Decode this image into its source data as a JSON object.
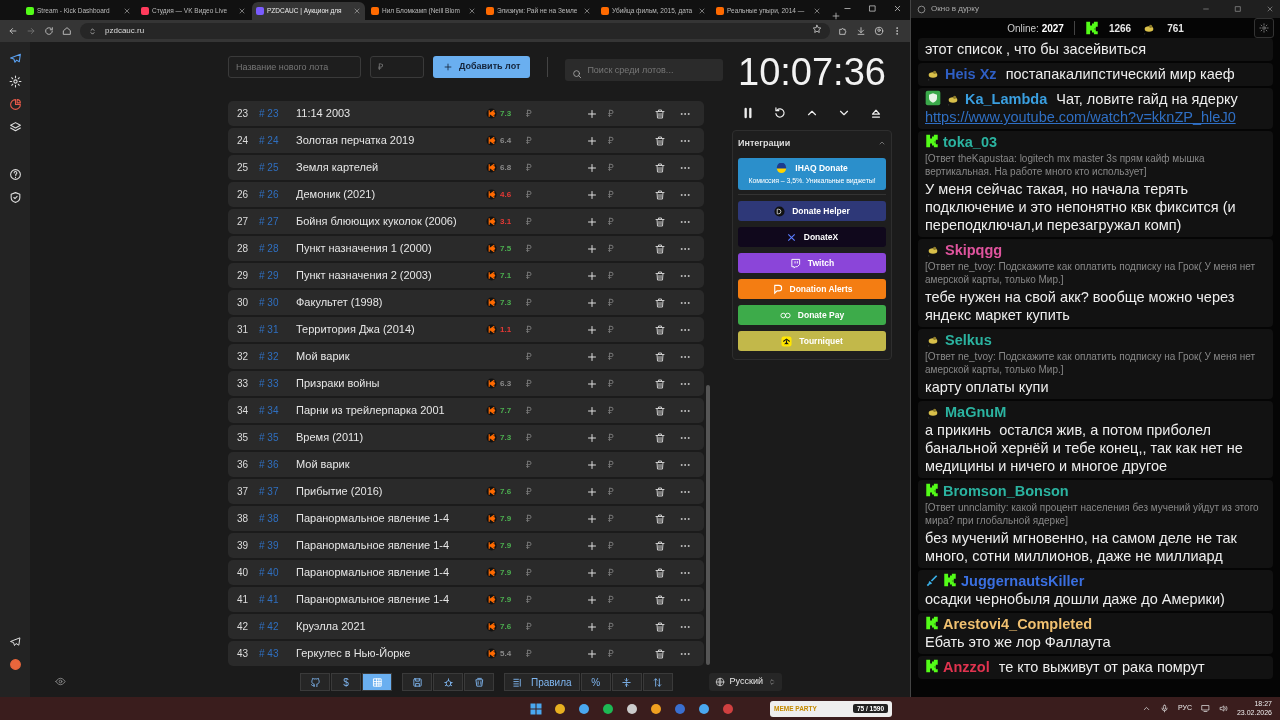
{
  "browser": {
    "tabs": [
      {
        "title": "Stream - Kick Dashboard",
        "color": "#53fc18",
        "selected": false
      },
      {
        "title": "Студия — VK Видео Live",
        "color": "#ff3b5c",
        "selected": false
      },
      {
        "title": "PZDCAUC | Аукцион для",
        "color": "#7a5cff",
        "selected": true
      },
      {
        "title": "Нил Бломкамп (Neill Blom",
        "color": "#ff6a00",
        "selected": false
      },
      {
        "title": "Элизиум: Рай не на Земле",
        "color": "#ff6a00",
        "selected": false
      },
      {
        "title": "Убийца фильм, 2015, дата",
        "color": "#ff6a00",
        "selected": false
      },
      {
        "title": "Реальные упыри, 2014 —",
        "color": "#ff6a00",
        "selected": false
      }
    ],
    "url": "pzdcauc.ru"
  },
  "toolbar": {
    "name_placeholder": "Название нового лота",
    "price_placeholder": "₽",
    "add_button": "Добавить лот",
    "search_placeholder": "Поиск среди лотов..."
  },
  "lots": [
    {
      "index": "23",
      "id": "# 23",
      "title": "11:14 2003",
      "rating": "7.3",
      "color": "#4caf50",
      "amount": "₽",
      "add_placeholder": "₽"
    },
    {
      "index": "24",
      "id": "# 24",
      "title": "Золотая перчатка 2019",
      "rating": "6.4",
      "color": "#8a8a8a",
      "amount": "₽",
      "add_placeholder": "₽"
    },
    {
      "index": "25",
      "id": "# 25",
      "title": "Земля картелей",
      "rating": "6.8",
      "color": "#8a8a8a",
      "amount": "₽",
      "add_placeholder": "₽"
    },
    {
      "index": "26",
      "id": "# 26",
      "title": "Демоник (2021)",
      "rating": "4.6",
      "color": "#e53935",
      "amount": "₽",
      "add_placeholder": "₽"
    },
    {
      "index": "27",
      "id": "# 27",
      "title": "Бойня блюющих куколок (2006)",
      "rating": "3.1",
      "color": "#e53935",
      "amount": "₽",
      "add_placeholder": "₽"
    },
    {
      "index": "28",
      "id": "# 28",
      "title": "Пункт назначения 1 (2000)",
      "rating": "7.5",
      "color": "#4caf50",
      "amount": "₽",
      "add_placeholder": "₽"
    },
    {
      "index": "29",
      "id": "# 29",
      "title": "Пункт назначения 2 (2003)",
      "rating": "7.1",
      "color": "#4caf50",
      "amount": "₽",
      "add_placeholder": "₽"
    },
    {
      "index": "30",
      "id": "# 30",
      "title": "Факультет (1998)",
      "rating": "7.3",
      "color": "#4caf50",
      "amount": "₽",
      "add_placeholder": "₽"
    },
    {
      "index": "31",
      "id": "# 31",
      "title": "Территория Джа (2014)",
      "rating": "1.1",
      "color": "#e53935",
      "amount": "₽",
      "add_placeholder": "₽"
    },
    {
      "index": "32",
      "id": "# 32",
      "title": "Мой варик",
      "amount": "₽",
      "add_placeholder": "₽"
    },
    {
      "index": "33",
      "id": "# 33",
      "title": "Призраки войны",
      "rating": "6.3",
      "color": "#8a8a8a",
      "amount": "₽",
      "add_placeholder": "₽"
    },
    {
      "index": "34",
      "id": "# 34",
      "title": "Парни из трейлерпарка 2001",
      "rating": "7.7",
      "color": "#4caf50",
      "amount": "₽",
      "add_placeholder": "₽"
    },
    {
      "index": "35",
      "id": "# 35",
      "title": "Время (2011)",
      "rating": "7.3",
      "color": "#4caf50",
      "amount": "₽",
      "add_placeholder": "₽"
    },
    {
      "index": "36",
      "id": "# 36",
      "title": "Мой варик",
      "amount": "₽",
      "add_placeholder": "₽"
    },
    {
      "index": "37",
      "id": "# 37",
      "title": "Прибытие (2016)",
      "rating": "7.6",
      "color": "#4caf50",
      "amount": "₽",
      "add_placeholder": "₽"
    },
    {
      "index": "38",
      "id": "# 38",
      "title": "Паранормальное явление 1-4",
      "rating": "7.9",
      "color": "#4caf50",
      "amount": "₽",
      "add_placeholder": "₽"
    },
    {
      "index": "39",
      "id": "# 39",
      "title": "Паранормальное явление 1-4",
      "rating": "7.9",
      "color": "#4caf50",
      "amount": "₽",
      "add_placeholder": "₽"
    },
    {
      "index": "40",
      "id": "# 40",
      "title": "Паранормальное явление 1-4",
      "rating": "7.9",
      "color": "#4caf50",
      "amount": "₽",
      "add_placeholder": "₽"
    },
    {
      "index": "41",
      "id": "# 41",
      "title": "Паранормальное явление 1-4",
      "rating": "7.9",
      "color": "#4caf50",
      "amount": "₽",
      "add_placeholder": "₽"
    },
    {
      "index": "42",
      "id": "# 42",
      "title": "Круэлла 2021",
      "rating": "7.6",
      "color": "#4caf50",
      "amount": "₽",
      "add_placeholder": "₽"
    },
    {
      "index": "43",
      "id": "# 43",
      "title": "Геркулес в Нью-Йорке",
      "rating": "5.4",
      "color": "#8a8a8a",
      "amount": "₽",
      "add_placeholder": "₽"
    }
  ],
  "bottom_bar": [
    {
      "selected": false
    },
    {
      "label": "$",
      "selected": false
    },
    {
      "selected": true
    },
    {
      "selected": false
    },
    {
      "selected": false
    },
    {
      "selected": false
    },
    {
      "label": "Правила",
      "selected": false
    },
    {
      "label": "%",
      "selected": false
    },
    {
      "selected": false
    },
    {
      "selected": false
    }
  ],
  "language": "Русский",
  "timer": "10:07:36",
  "integrations": {
    "title": "Интеграции",
    "expanded": true,
    "buttons": [
      {
        "label": "IHAQ Donate",
        "subtitle": "Комиссия – 3,5%. Уникальные виджеты!",
        "color": "#2b8fcb"
      },
      {
        "label": "Donate Helper",
        "color": "#2e3878"
      },
      {
        "label": "DonateX",
        "color": "#10081c"
      },
      {
        "label": "Twitch",
        "color": "#8b45d9"
      },
      {
        "label": "Donation Alerts",
        "color": "#f47d12"
      },
      {
        "label": "Donate Pay",
        "color": "#3dab4a"
      },
      {
        "label": "Tourniquet",
        "color": "#c2b84a"
      }
    ]
  },
  "chat": {
    "title": "Окно в дурку",
    "online_label": "Online:",
    "online": "2027",
    "kick_count": "1266",
    "other_count": "761",
    "messages": [
      {
        "text": "этот список , что бы засейвиться"
      },
      {
        "badges": [
          {
            "kind": "emblem"
          }
        ],
        "name": "Heis Xz",
        "color": "#2f5fc4",
        "text": "постапакалипстический мир каеф"
      },
      {
        "badges": [
          {
            "kind": "shield"
          },
          {
            "kind": "emblem"
          }
        ],
        "name": "Ka_Lambda",
        "color": "#3a9fe0",
        "text": "Чат, ловите гайд на ядерку",
        "link": "https://www.youtube.com/watch?v=kknZP_hleJ0"
      },
      {
        "badges": [
          {
            "kind": "kick"
          }
        ],
        "name": "toka_03",
        "color": "#2bb3a0",
        "reply": "[Ответ theKapustaa: logitech mx master 3s прям кайф мышка вертикальная. На работе много кто использует]",
        "text": "У меня сейчас такая, но начала терять подключение и это непонятно квк фиксится (и переподключал,и перезагружал комп)"
      },
      {
        "badges": [
          {
            "kind": "emblem"
          }
        ],
        "name": "Skipqgg",
        "color": "#e0549e",
        "reply": "[Ответ ne_tvoy: Подскажите как оплатить подписку на Грок( У меня нет амерской карты, только Мир.]",
        "text": "тебе нужен на свой акк? вообще можно через яндекс маркет купить"
      },
      {
        "badges": [
          {
            "kind": "emblem"
          }
        ],
        "name": "Selkus",
        "color": "#2bb3a0",
        "reply": "[Ответ ne_tvoy: Подскажите как оплатить подписку на Грок( У меня нет амерской карты, только Мир.]",
        "text": "карту оплаты купи"
      },
      {
        "badges": [
          {
            "kind": "emblem"
          }
        ],
        "name": "MaGnuM",
        "color": "#2bb3a0",
        "text": "а прикинь  остался жив, а потом приболел банальной хернёй и тебе конец,, так как нет не медицины и ничего и многое другое"
      },
      {
        "badges": [
          {
            "kind": "kick"
          }
        ],
        "name": "Bromson_Bonson",
        "color": "#2bb3a0",
        "reply": "[Ответ unnclamity: какой процент населения без мучений уйдут из этого мира? при глобальной ядерке]",
        "text": "без мучений мгновенно, на самом деле не так много, сотни миллионов, даже не миллиард"
      },
      {
        "badges": [
          {
            "kind": "sword"
          },
          {
            "kind": "kick"
          }
        ],
        "name": "JuggernautsKiller",
        "color": "#3a6fe0",
        "text": "осадки чернобыля дошли даже до Америки)"
      },
      {
        "badges": [
          {
            "kind": "kick"
          }
        ],
        "name": "Arestovi4_Completed",
        "color": "#f0c070",
        "text": "Ебать это же лор Фаллаута"
      },
      {
        "badges": [
          {
            "kind": "kick"
          }
        ],
        "name": "Anzzol",
        "color": "#e0334f",
        "text": "те кто выживут от рака помрут"
      }
    ]
  },
  "taskbar": {
    "widget_title": "MEME PARTY",
    "widget_count": "75 / 1590",
    "language": "РУС",
    "time": "18:27",
    "date": "23.02.2026"
  }
}
